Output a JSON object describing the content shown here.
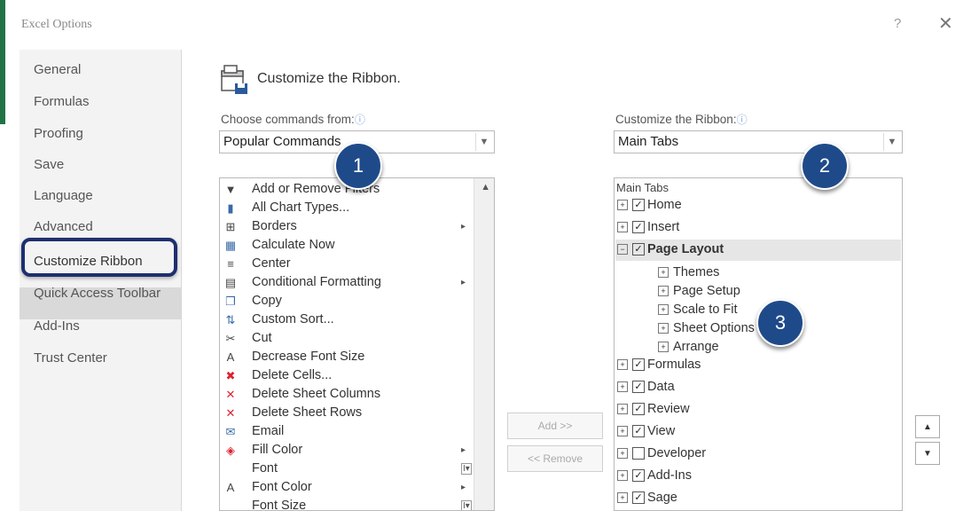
{
  "window": {
    "title": "Excel Options",
    "help": "?",
    "close": "✕"
  },
  "sidebar": {
    "items": [
      {
        "label": "General"
      },
      {
        "label": "Formulas"
      },
      {
        "label": "Proofing"
      },
      {
        "label": "Save"
      },
      {
        "label": "Language"
      },
      {
        "label": "Advanced"
      },
      {
        "label": "Customize Ribbon"
      },
      {
        "label": "Quick Access Toolbar"
      },
      {
        "label": "Add-Ins"
      },
      {
        "label": "Trust Center"
      }
    ],
    "selected": "Customize Ribbon"
  },
  "main": {
    "heading": "Customize the Ribbon.",
    "choose_label": "Choose commands from:",
    "choose_value": "Popular Commands",
    "customize_label": "Customize the Ribbon:",
    "customize_value": "Main Tabs",
    "info_glyph": "ⓘ",
    "commands": [
      {
        "label": "Add or Remove Filters",
        "icon": "filter-icon",
        "glyph": "▼"
      },
      {
        "label": "All Chart Types...",
        "icon": "chart-icon",
        "glyph": "▮"
      },
      {
        "label": "Borders",
        "icon": "borders-icon",
        "glyph": "⊞",
        "sub": true
      },
      {
        "label": "Calculate Now",
        "icon": "calculator-icon",
        "glyph": "▦"
      },
      {
        "label": "Center",
        "icon": "center-align-icon",
        "glyph": "≡"
      },
      {
        "label": "Conditional Formatting",
        "icon": "conditional-formatting-icon",
        "glyph": "▤",
        "sub": true
      },
      {
        "label": "Copy",
        "icon": "copy-icon",
        "glyph": "❐"
      },
      {
        "label": "Custom Sort...",
        "icon": "sort-icon",
        "glyph": "⇅"
      },
      {
        "label": "Cut",
        "icon": "scissors-icon",
        "glyph": "✂"
      },
      {
        "label": "Decrease Font Size",
        "icon": "decrease-font-icon",
        "glyph": "A"
      },
      {
        "label": "Delete Cells...",
        "icon": "delete-cells-icon",
        "glyph": "✖"
      },
      {
        "label": "Delete Sheet Columns",
        "icon": "delete-columns-icon",
        "glyph": "✕"
      },
      {
        "label": "Delete Sheet Rows",
        "icon": "delete-rows-icon",
        "glyph": "✕"
      },
      {
        "label": "Email",
        "icon": "email-icon",
        "glyph": "✉"
      },
      {
        "label": "Fill Color",
        "icon": "fill-color-icon",
        "glyph": "◈",
        "sub": true
      },
      {
        "label": "Font",
        "icon": "font-icon",
        "glyph": "",
        "combo": true
      },
      {
        "label": "Font Color",
        "icon": "font-color-icon",
        "glyph": "A",
        "sub": true
      },
      {
        "label": "Font Size",
        "icon": "font-size-icon",
        "glyph": "",
        "combo": true
      }
    ],
    "add_button": "Add >>",
    "remove_button": "<< Remove",
    "tree_header": "Main Tabs",
    "tabs_before": [
      {
        "label": "Home",
        "checked": true
      },
      {
        "label": "Insert",
        "checked": true
      }
    ],
    "expanded_tab": {
      "label": "Page Layout",
      "checked": true
    },
    "groups": [
      "Themes",
      "Page Setup",
      "Scale to Fit",
      "Sheet Options",
      "Arrange"
    ],
    "tabs_after": [
      {
        "label": "Formulas",
        "checked": true
      },
      {
        "label": "Data",
        "checked": true
      },
      {
        "label": "Review",
        "checked": true
      },
      {
        "label": "View",
        "checked": true
      },
      {
        "label": "Developer",
        "checked": false
      },
      {
        "label": "Add-Ins",
        "checked": true
      },
      {
        "label": "Sage",
        "checked": true
      }
    ],
    "move_up": "▲",
    "move_down": "▼"
  },
  "callouts": [
    "1",
    "2",
    "3"
  ],
  "colors": {
    "callout": "#1f4a8a",
    "highlight_ring": "#1d2f6e",
    "excel_green": "#217346"
  }
}
